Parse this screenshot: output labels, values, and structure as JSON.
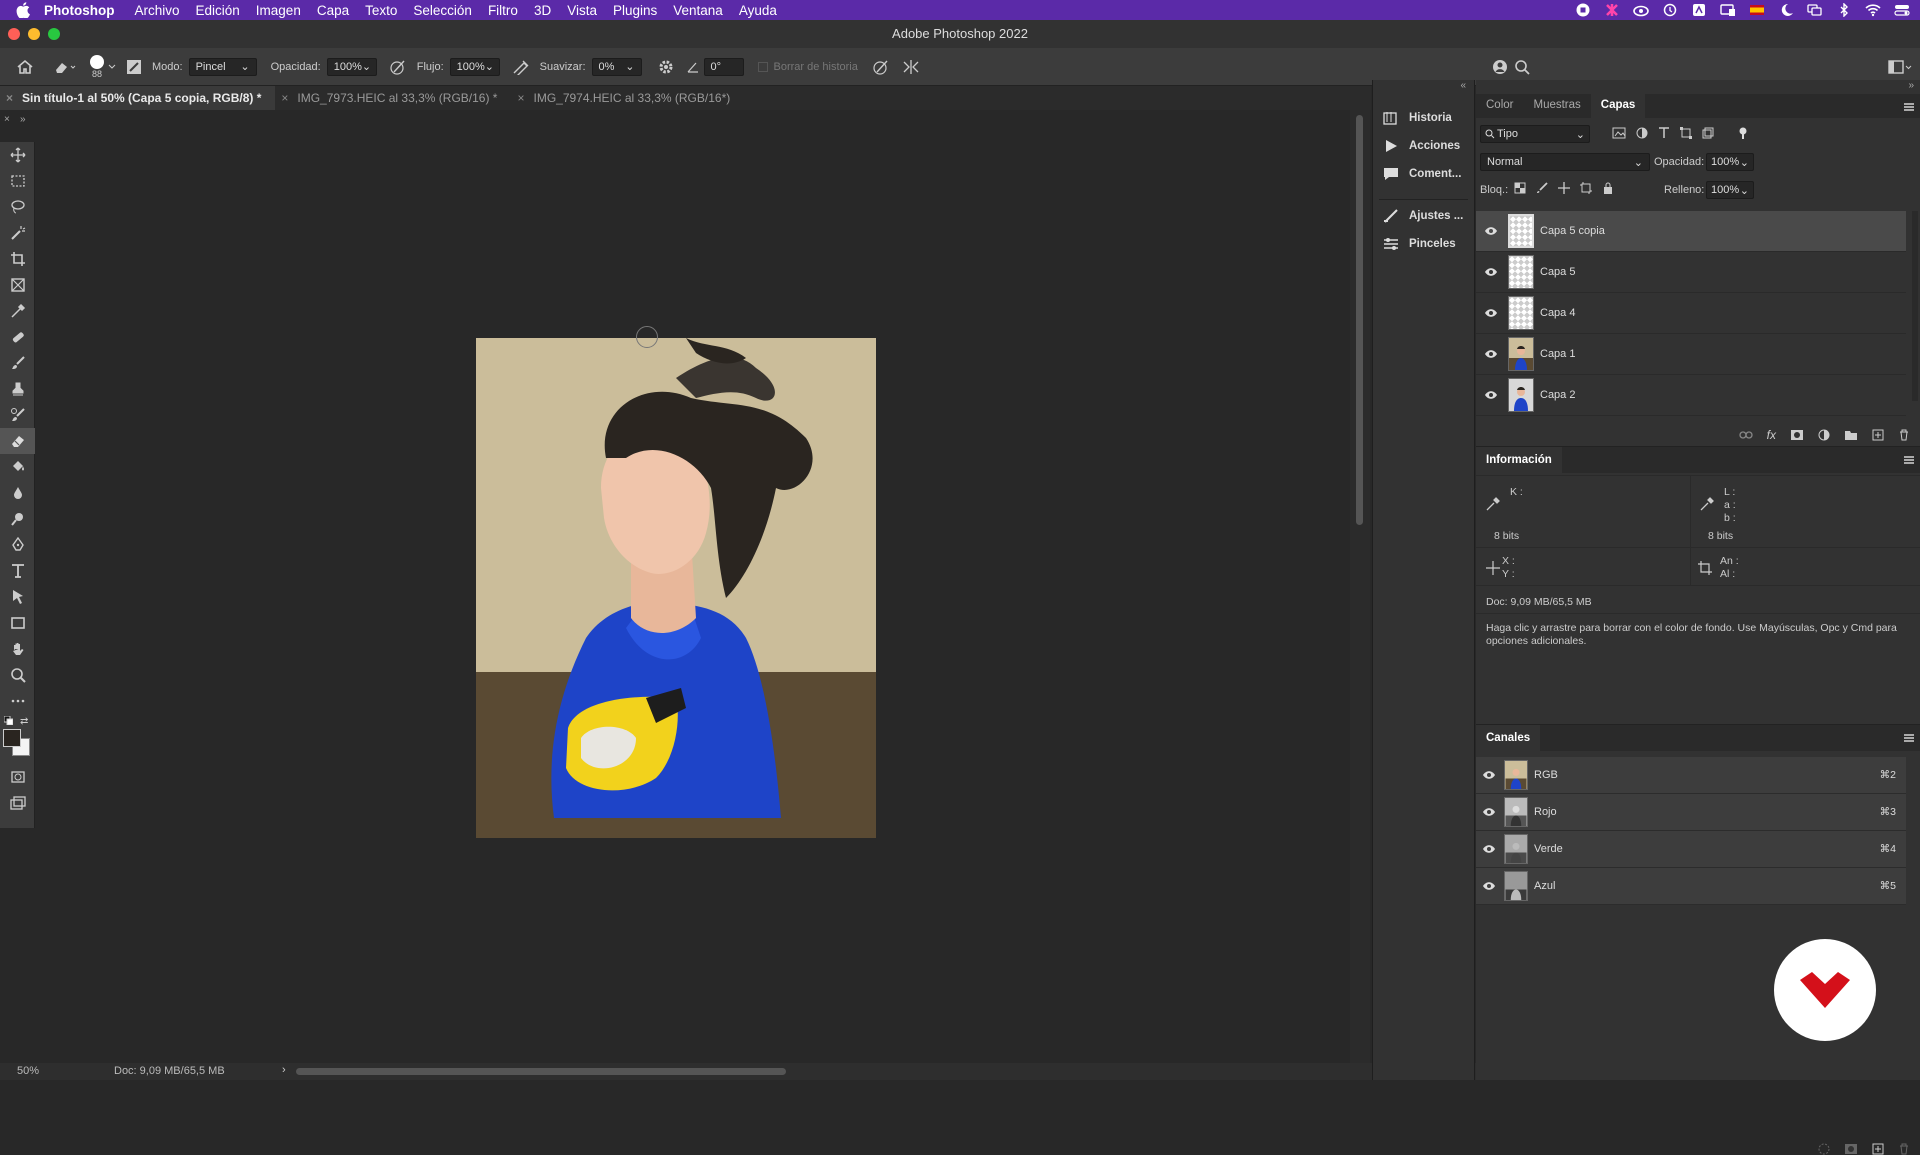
{
  "menubar": {
    "app": "Photoshop",
    "items": [
      "Archivo",
      "Edición",
      "Imagen",
      "Capa",
      "Texto",
      "Selección",
      "Filtro",
      "3D",
      "Vista",
      "Plugins",
      "Ventana",
      "Ayuda"
    ]
  },
  "window": {
    "title": "Adobe Photoshop 2022"
  },
  "options": {
    "brush_size": "88",
    "mode_label": "Modo:",
    "mode_value": "Pincel",
    "opacity_label": "Opacidad:",
    "opacity_value": "100%",
    "flow_label": "Flujo:",
    "flow_value": "100%",
    "smooth_label": "Suavizar:",
    "smooth_value": "0%",
    "angle_value": "0°",
    "erase_history": "Borrar de historia"
  },
  "tabs": [
    {
      "label": "Sin título-1 al 50% (Capa 5 copia, RGB/8) *",
      "active": true
    },
    {
      "label": "IMG_7973.HEIC al 33,3% (RGB/16) *",
      "active": false
    },
    {
      "label": "IMG_7974.HEIC al 33,3% (RGB/16*)",
      "active": false
    }
  ],
  "tools": [
    "move-tool",
    "marquee-tool",
    "lasso-tool",
    "magic-wand-tool",
    "crop-tool",
    "frame-tool",
    "eyedropper-tool",
    "healing-brush-tool",
    "brush-tool",
    "clone-stamp-tool",
    "history-brush-tool",
    "eraser-tool",
    "paint-bucket-tool",
    "blur-tool",
    "dodge-tool",
    "pen-tool",
    "type-tool",
    "path-selection-tool",
    "rectangle-tool",
    "hand-tool",
    "zoom-tool",
    "more-tools"
  ],
  "side_strip": {
    "items": [
      {
        "label": "Historia",
        "icon": "history-icon"
      },
      {
        "label": "Acciones",
        "icon": "play-icon"
      },
      {
        "label": "Coment...",
        "icon": "comment-icon"
      },
      {
        "label": "Ajustes ...",
        "icon": "adjustments-icon"
      },
      {
        "label": "Pinceles",
        "icon": "brushes-icon"
      }
    ]
  },
  "layers_panel": {
    "tabs": [
      "Color",
      "Muestras",
      "Capas"
    ],
    "active_tab": "Capas",
    "filter_label": "Tipo",
    "blend_mode": "Normal",
    "opacity_label": "Opacidad:",
    "opacity_value": "100%",
    "lock_label": "Bloq.:",
    "fill_label": "Relleno:",
    "fill_value": "100%",
    "layers": [
      {
        "name": "Capa 5 copia",
        "selected": true,
        "thumb": "transparent"
      },
      {
        "name": "Capa 5",
        "selected": false,
        "thumb": "transparent"
      },
      {
        "name": "Capa 4",
        "selected": false,
        "thumb": "transparent"
      },
      {
        "name": "Capa 1",
        "selected": false,
        "thumb": "photo"
      },
      {
        "name": "Capa 2",
        "selected": false,
        "thumb": "photo"
      }
    ]
  },
  "info_panel": {
    "title": "Información",
    "k_label": "K :",
    "l_label": "L :",
    "a_label": "a :",
    "b_label": "b :",
    "bits_left": "8 bits",
    "bits_right": "8 bits",
    "x_label": "X :",
    "y_label": "Y :",
    "w_label": "An :",
    "h_label": "Al :",
    "doc": "Doc: 9,09 MB/65,5 MB",
    "hint": "Haga clic y arrastre para borrar con el color de fondo. Use Mayúsculas, Opc y Cmd para opciones adicionales."
  },
  "channels_panel": {
    "title": "Canales",
    "channels": [
      {
        "name": "RGB",
        "shortcut": "⌘2"
      },
      {
        "name": "Rojo",
        "shortcut": "⌘3"
      },
      {
        "name": "Verde",
        "shortcut": "⌘4"
      },
      {
        "name": "Azul",
        "shortcut": "⌘5"
      }
    ]
  },
  "status": {
    "zoom": "50%",
    "doc": "Doc: 9,09 MB/65,5 MB"
  },
  "colors": {
    "menubar": "#5b2aa8",
    "hoodie": "#1e44c8",
    "background_top": "#cbbd9a",
    "background_bottom": "#5a4a33",
    "logo_red": "#d4101a"
  }
}
